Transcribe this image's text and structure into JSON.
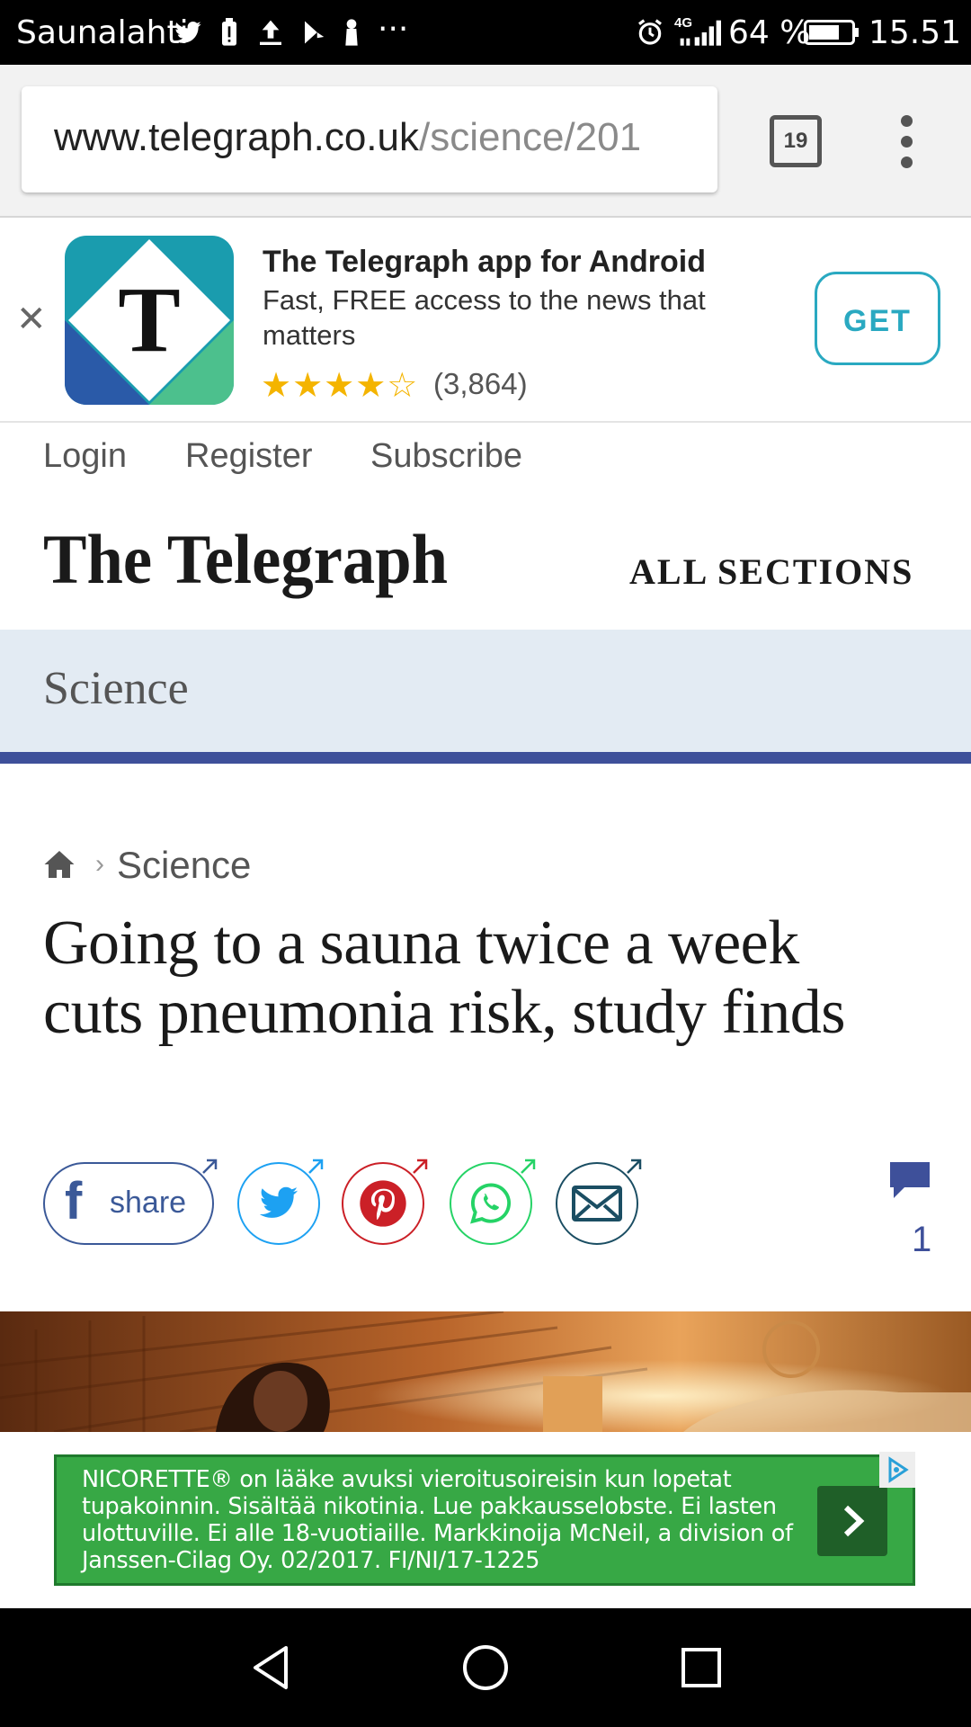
{
  "status_bar": {
    "carrier": "Saunalahti",
    "battery_percent": "64 %",
    "time": "15.51",
    "network_type": "4G",
    "icons": [
      "twitter-icon",
      "battery-saver-icon",
      "upload-icon",
      "play-store-icon",
      "notification-icon",
      "more-icon",
      "alarm-icon",
      "signal-icon",
      "battery-icon"
    ]
  },
  "browser": {
    "url_host": "www.telegraph.co.uk",
    "url_path": "/science/201",
    "tab_count": "19"
  },
  "app_banner": {
    "title": "The Telegraph app for Android",
    "description": "Fast, FREE access to the news that matters",
    "stars": "★★★★☆",
    "rating": 4,
    "reviews": "(3,864)",
    "get_label": "GET",
    "icon_letter": "T",
    "colors": {
      "teal": "#1a9cae",
      "blue": "#2a5aa8",
      "green": "#4cc08d",
      "get": "#2aa9c1"
    }
  },
  "account_links": {
    "login": "Login",
    "register": "Register",
    "subscribe": "Subscribe"
  },
  "masthead": {
    "logo_text": "The Telegraph",
    "all_sections": "ALL SECTIONS"
  },
  "section": {
    "title": "Science",
    "band_color": "#e3ebf3",
    "rule_color": "#3e509a"
  },
  "article": {
    "breadcrumb": "Science",
    "breadcrumb_sep": "›",
    "headline": "Going to a sauna twice a week cuts pneumonia risk, study finds",
    "share_label": "share",
    "comment_count": "1",
    "share_colors": {
      "facebook": "#3b5998",
      "twitter": "#1da1f2",
      "pinterest": "#cb2027",
      "whatsapp": "#25d366",
      "email": "#1b4e63"
    }
  },
  "ad": {
    "text": "NICORETTE® on lääke avuksi vieroitusoireisin kun lopetat tupakoinnin. Sisältää nikotinia. Lue pakkausselobste. Ei lasten ulottuville. Ei alle 18-vuotiaille. Markkinoija McNeil, a division of Janssen-Cilag Oy. 02/2017. FI/NI/17-1225",
    "color": "#37a845"
  }
}
